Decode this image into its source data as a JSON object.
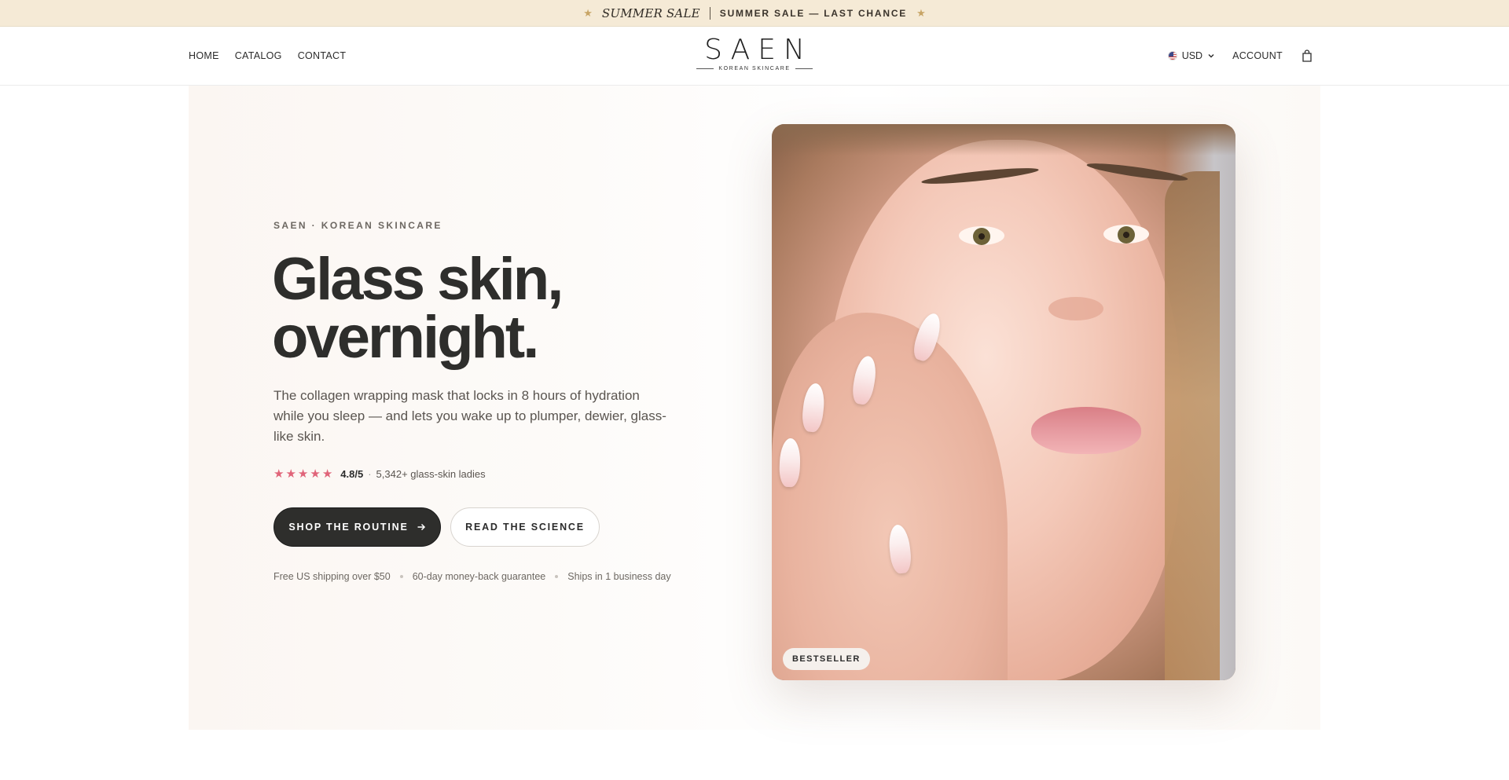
{
  "announcement": {
    "script_text": "SUMMER SALE",
    "main_text": "SUMMER SALE — LAST CHANCE",
    "star_icon": "★"
  },
  "header": {
    "nav": [
      {
        "label": "HOME"
      },
      {
        "label": "CATALOG"
      },
      {
        "label": "CONTACT"
      }
    ],
    "logo": {
      "wordmark": "SAEN",
      "tagline": "KOREAN SKINCARE"
    },
    "currency": "USD",
    "account_label": "ACCOUNT",
    "icons": {
      "flag": "us-flag-icon",
      "chevron": "chevron-down-icon",
      "bag": "shopping-bag-icon"
    }
  },
  "hero": {
    "eyebrow": "SAEN · KOREAN SKINCARE",
    "headline_line1": "Glass skin,",
    "headline_line2": "overnight.",
    "subtitle": "The collagen wrapping mask that locks in 8 hours of hydration while you sleep — and lets you wake up to plumper, dewier, glass-like skin.",
    "rating": {
      "stars": 5,
      "score": "4.8/5",
      "separator": "·",
      "count": "5,342+ glass-skin ladies"
    },
    "primary_button": "SHOP THE ROUTINE",
    "secondary_button": "READ THE SCIENCE",
    "trust": [
      "Free US shipping over $50",
      "60-day money-back guarantee",
      "Ships in 1 business day"
    ],
    "image_badge": "BESTSELLER"
  },
  "colors": {
    "announcement_bg": "#f5ead6",
    "star_gold": "#c8a566",
    "rating_pink": "#e06479",
    "primary_button_bg": "#2e2e2c",
    "headline": "#2e2e2c"
  }
}
